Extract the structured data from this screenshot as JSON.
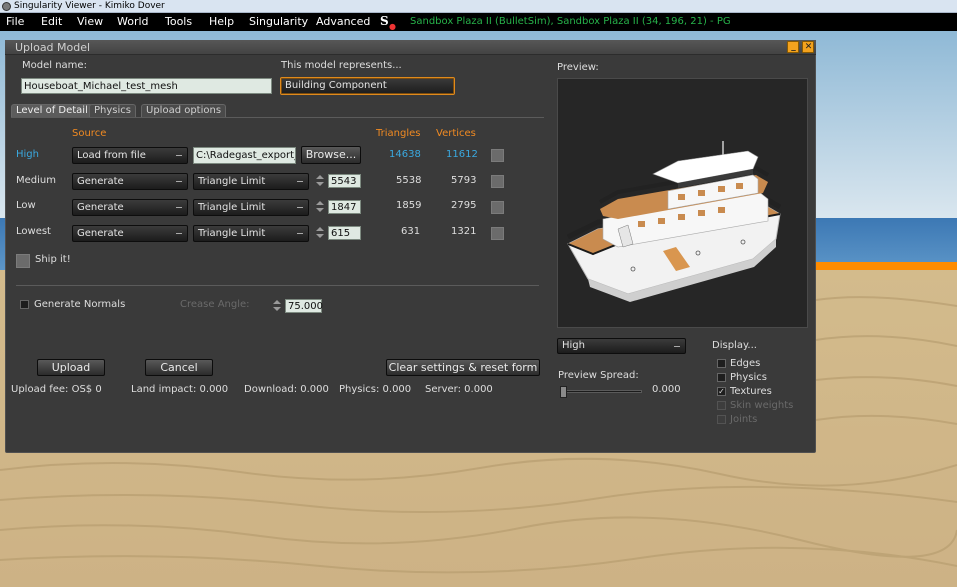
{
  "window": {
    "title": "Singularity Viewer - Kimiko Dover"
  },
  "menu": [
    "File",
    "Edit",
    "View",
    "World",
    "Tools",
    "Help",
    "Singularity",
    "Advanced"
  ],
  "location": "Sandbox Plaza II (BulletSim), Sandbox Plaza II (34, 196, 21) - PG",
  "floater": {
    "title": "Upload Model",
    "model_name_label": "Model name:",
    "model_name_value": "Houseboat_Michael_test_mesh",
    "represents_label": "This model represents...",
    "represents_value": "Building Component",
    "tabs": [
      "Level of Detail",
      "Physics",
      "Upload options"
    ],
    "lod": {
      "col_source": "Source",
      "col_triangles": "Triangles",
      "col_vertices": "Vertices",
      "rows": [
        {
          "name": "High",
          "source": "Load from file",
          "method": "C:\\Radegast_export_d",
          "action": "Browse...",
          "limit": "",
          "triangles": "14638",
          "vertices": "11612"
        },
        {
          "name": "Medium",
          "source": "Generate",
          "method": "Triangle Limit",
          "action": "",
          "limit": "5543",
          "triangles": "5538",
          "vertices": "5793"
        },
        {
          "name": "Low",
          "source": "Generate",
          "method": "Triangle Limit",
          "action": "",
          "limit": "1847",
          "triangles": "1859",
          "vertices": "2795"
        },
        {
          "name": "Lowest",
          "source": "Generate",
          "method": "Triangle Limit",
          "action": "",
          "limit": "615",
          "triangles": "631",
          "vertices": "1321"
        }
      ],
      "ship_it": "Ship it!",
      "generate_normals": "Generate Normals",
      "crease_angle_label": "Crease Angle:",
      "crease_angle_value": "75.000"
    },
    "buttons": {
      "upload": "Upload",
      "cancel": "Cancel",
      "clear": "Clear settings & reset form"
    },
    "fees": {
      "upload_fee": "Upload fee: OS$ 0",
      "land_impact": "Land impact: 0.000",
      "download": "Download: 0.000",
      "physics": "Physics: 0.000",
      "server": "Server: 0.000"
    },
    "preview": {
      "label": "Preview:",
      "lod_select": "High",
      "spread_label": "Preview Spread:",
      "spread_value": "0.000",
      "display_label": "Display...",
      "options": [
        {
          "label": "Edges",
          "checked": false,
          "enabled": true
        },
        {
          "label": "Physics",
          "checked": false,
          "enabled": true
        },
        {
          "label": "Textures",
          "checked": true,
          "enabled": true
        },
        {
          "label": "Skin weights",
          "checked": false,
          "enabled": false
        },
        {
          "label": "Joints",
          "checked": false,
          "enabled": false
        }
      ]
    }
  },
  "colors": {
    "accent": "#f08a22",
    "link": "#3aa9e0",
    "location": "#27b24a",
    "panel": "#3a3a3a"
  }
}
